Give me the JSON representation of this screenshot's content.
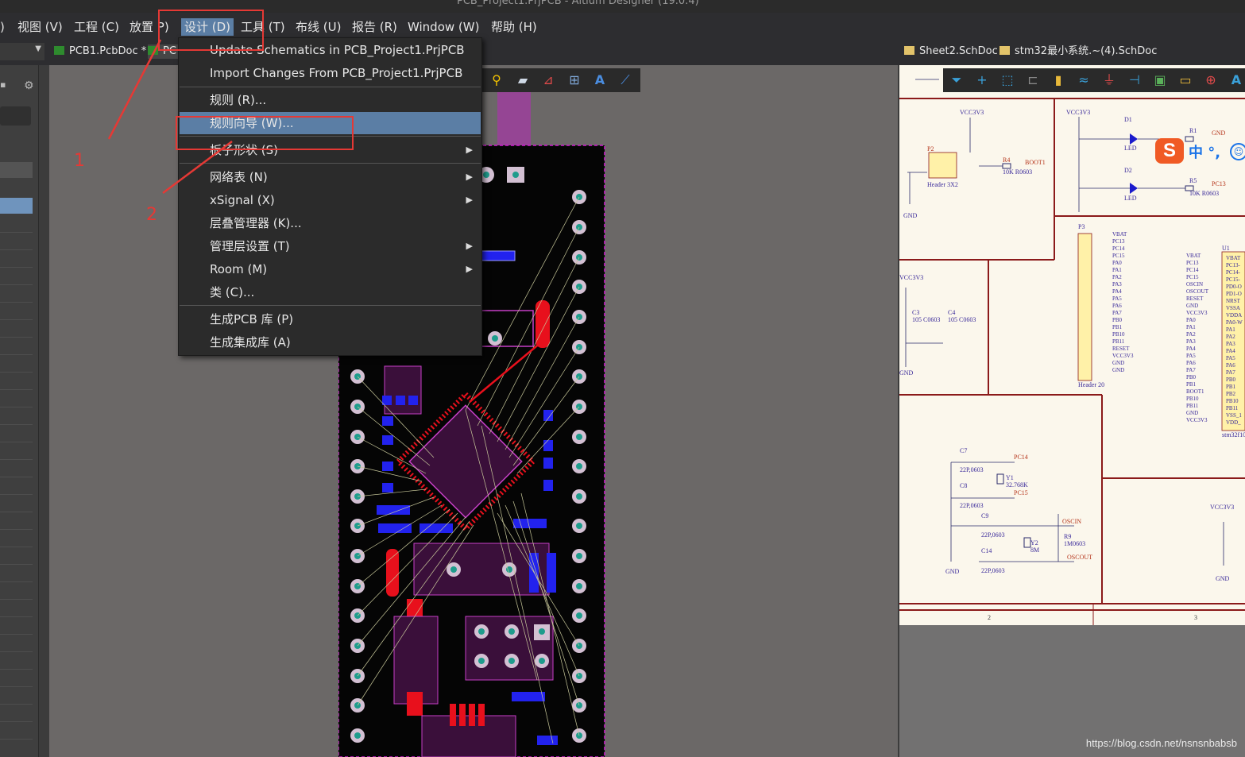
{
  "window": {
    "title": "PCB_Project1.PrjPCB - Altium Designer (19.0.4)"
  },
  "menubar": {
    "items": [
      {
        "label": ")"
      },
      {
        "label": "视图 (V)"
      },
      {
        "label": "工程 (C)"
      },
      {
        "label": "放置 P)"
      },
      {
        "label": "设计 (D)"
      },
      {
        "label": "工具 (T)"
      },
      {
        "label": "布线 (U)"
      },
      {
        "label": "报告 (R)"
      },
      {
        "label": "Window (W)"
      },
      {
        "label": "帮助 (H)"
      }
    ]
  },
  "tabs": [
    {
      "label": "PCB1.PcbDoc *"
    },
    {
      "label": "PC"
    },
    {
      "label": "Sheet2.SchDoc"
    },
    {
      "label": "stm32最小系统.~(4).SchDoc"
    }
  ],
  "design_menu": {
    "items": [
      {
        "label": "Update Schematics in PCB_Project1.PrjPCB",
        "submenu": false
      },
      {
        "label": "Import Changes From PCB_Project1.PrjPCB",
        "submenu": false
      },
      {
        "label": "规则 (R)...",
        "submenu": false
      },
      {
        "label": "规则向导 (W)...",
        "submenu": false,
        "selected": true
      },
      {
        "label": "板子形状 (S)",
        "submenu": true
      },
      {
        "label": "网络表 (N)",
        "submenu": true
      },
      {
        "label": "xSignal (X)",
        "submenu": true
      },
      {
        "label": "层叠管理器 (K)...",
        "submenu": false
      },
      {
        "label": "管理层设置 (T)",
        "submenu": true
      },
      {
        "label": "Room (M)",
        "submenu": true
      },
      {
        "label": "类 (C)...",
        "submenu": false
      },
      {
        "label": "生成PCB 库 (P)",
        "submenu": false
      },
      {
        "label": "生成集成库 (A)",
        "submenu": false
      }
    ],
    "arrow_glyph": "▶"
  },
  "annotations": {
    "step1": "1",
    "step2": "2"
  },
  "schematic": {
    "labels": {
      "vcc1": "VCC3V3",
      "vcc2": "VCC3V3",
      "vcc3": "VCC3V3",
      "vcc4": "VCC3V3",
      "p2": "P2",
      "header3x2": "Header 3X2",
      "r4": "R4",
      "r4v": "10K R0603",
      "boot1": "BOOT1",
      "d1": "D1",
      "d2": "D2",
      "led1": "LED",
      "led2": "LED",
      "r1": "R1",
      "r5": "R5",
      "r5v": "10K R0603",
      "gnd1": "GND",
      "gnd2": "GND",
      "gnd3": "GND",
      "gnd4": "GND",
      "gnd5": "GND",
      "pc13": "PC13",
      "c3": "C3",
      "c3v": "105 C0603",
      "c4": "C4",
      "c4v": "105 C0603",
      "p3": "P3",
      "header20": "Header 20",
      "u1": "U1",
      "stm": "stm32f10",
      "c7": "C7",
      "c7v": "22P,0603",
      "c8": "C8",
      "c8v": "22P,0603",
      "y1": "Y1",
      "y1v": "32.768K",
      "pc14": "PC14",
      "pc15": "PC15",
      "c9": "C9",
      "c9v": "22P,0603",
      "c14": "C14",
      "c14v": "22P,0603",
      "y2": "Y2",
      "y2v": "8M",
      "r9": "R9",
      "r9v": "1M0603",
      "oscin": "OSCIN",
      "oscout": "OSCOUT",
      "zone2": "2",
      "zone3": "3"
    },
    "p3_pins": [
      "VBAT",
      "PC13",
      "PC14",
      "PC15",
      "PA0",
      "PA1",
      "PA2",
      "PA3",
      "PA4",
      "PA5",
      "PA6",
      "PA7",
      "PB0",
      "PB1",
      "PB10",
      "PB11",
      "RESET",
      "VCC3V3",
      "GND",
      "GND"
    ],
    "u1_pins_left": [
      "VBAT",
      "PC13",
      "PC14",
      "PC15",
      "OSCIN",
      "OSCOUT",
      "RESET",
      "GND",
      "VCC3V3",
      "PA0",
      "PA1",
      "PA2",
      "PA3",
      "PA4",
      "PA5",
      "PA6",
      "PA7",
      "PB0",
      "PB1",
      "BOOT1",
      "PB10",
      "PB11",
      "GND",
      "VCC3V3"
    ],
    "u1_pins_right": [
      "VBAT",
      "PC13-",
      "PC14-",
      "PC15-",
      "PD0-O",
      "PD1-O",
      "NRST",
      "VSSA",
      "VDDA",
      "PA0-W",
      "PA1",
      "PA2",
      "PA3",
      "PA4",
      "PA5",
      "PA6",
      "PA7",
      "PB0",
      "PB1",
      "PB2",
      "PB10",
      "PB11",
      "VSS_1",
      "VDD_"
    ]
  },
  "ime": {
    "logo": "S",
    "text": "中 °,"
  },
  "watermark": "https://blog.csdn.net/nsnsnbabsb",
  "colors": {
    "accent": "#5b7ea5",
    "annotation": "#e53935",
    "board_outline": "#d31cd3"
  }
}
